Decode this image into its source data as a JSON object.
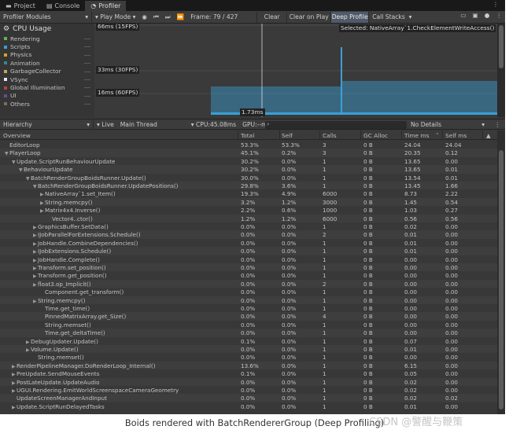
{
  "tabs": [
    {
      "label": "Project",
      "icon": "folder-icon"
    },
    {
      "label": "Console",
      "icon": "console-icon"
    },
    {
      "label": "Profiler",
      "icon": "profiler-icon"
    }
  ],
  "toolbar": {
    "modules": "Profiler Modules",
    "play_mode": "Play Mode",
    "frame": "Frame: 79 / 427",
    "clear": "Clear",
    "clear_on_play": "Clear on Play",
    "deep_profile": "Deep Profile",
    "call_stacks": "Call Stacks"
  },
  "cpu": {
    "title": "CPU Usage",
    "legend": [
      {
        "label": "Rendering",
        "color": "#66b34f"
      },
      {
        "label": "Scripts",
        "color": "#3aa0d6"
      },
      {
        "label": "Physics",
        "color": "#d6a21e"
      },
      {
        "label": "Animation",
        "color": "#2f8b8f"
      },
      {
        "label": "GarbageCollector",
        "color": "#c7a55a"
      },
      {
        "label": "VSync",
        "color": "#e8e8e8"
      },
      {
        "label": "Global Illumination",
        "color": "#b0424a"
      },
      {
        "label": "UI",
        "color": "#6a4a9a"
      },
      {
        "label": "Others",
        "color": "#7f6c5a"
      }
    ]
  },
  "chart": {
    "label_66": "66ms (15FPS)",
    "label_33": "33ms (30FPS)",
    "label_16": "16ms (60FPS)",
    "selected": "Selected: NativeArray`1.CheckElementWriteAccess()",
    "cursor": "1.73ms",
    "accent": "#3aa0d6"
  },
  "hier": {
    "view": "Hierarchy",
    "live": "Live",
    "thread": "Main Thread",
    "cpu": "CPU:45.08ms",
    "gpu": "GPU:--ms",
    "details": "No Details"
  },
  "columns": {
    "overview": "Overview",
    "total": "Total",
    "self": "Self",
    "calls": "Calls",
    "gc": "GC Alloc",
    "time": "Time ms",
    "selfms": "Self ms"
  },
  "rows": [
    [
      "",
      "EditorLoop",
      "53.3%",
      "53.3%",
      "3",
      "0 B",
      "24.04",
      "24.04"
    ],
    [
      "▼",
      "PlayerLoop",
      "45.1%",
      "0.2%",
      "3",
      "0 B",
      "20.35",
      "0.12"
    ],
    [
      "▼",
      "Update.ScriptRunBehaviourUpdate",
      "30.2%",
      "0.0%",
      "1",
      "0 B",
      "13.65",
      "0.00"
    ],
    [
      "▼",
      "BehaviourUpdate",
      "30.2%",
      "0.0%",
      "1",
      "0 B",
      "13.65",
      "0.01"
    ],
    [
      "▼",
      "BatchRenderGroupBoidsRunner.Update()",
      "30.0%",
      "0.0%",
      "1",
      "0 B",
      "13.54",
      "0.01"
    ],
    [
      "▼",
      "BatchRenderGroupBoidsRunner.UpdatePositions()",
      "29.8%",
      "3.6%",
      "1",
      "0 B",
      "13.45",
      "1.66"
    ],
    [
      "▶",
      "NativeArray`1.set_Item()",
      "19.3%",
      "4.9%",
      "6000",
      "0 B",
      "8.73",
      "2.22"
    ],
    [
      "▶",
      "String.memcpy()",
      "3.2%",
      "1.2%",
      "3000",
      "0 B",
      "1.45",
      "0.54"
    ],
    [
      "▶",
      "Matrix4x4.Inverse()",
      "2.2%",
      "0.6%",
      "1000",
      "0 B",
      "1.03",
      "0.27"
    ],
    [
      "",
      "Vector4..ctor()",
      "1.2%",
      "1.2%",
      "6000",
      "0 B",
      "0.56",
      "0.56"
    ],
    [
      "▶",
      "GraphicsBuffer.SetData()",
      "0.0%",
      "0.0%",
      "1",
      "0 B",
      "0.02",
      "0.00"
    ],
    [
      "▶",
      "IJobParallelForExtensions.Schedule()",
      "0.0%",
      "0.0%",
      "2",
      "0 B",
      "0.01",
      "0.00"
    ],
    [
      "▶",
      "JobHandle.CombineDependencies()",
      "0.0%",
      "0.0%",
      "1",
      "0 B",
      "0.01",
      "0.00"
    ],
    [
      "▶",
      "IJobExtensions.Schedule()",
      "0.0%",
      "0.0%",
      "1",
      "0 B",
      "0.01",
      "0.00"
    ],
    [
      "▶",
      "JobHandle.Complete()",
      "0.0%",
      "0.0%",
      "1",
      "0 B",
      "0.00",
      "0.00"
    ],
    [
      "▶",
      "Transform.set_position()",
      "0.0%",
      "0.0%",
      "1",
      "0 B",
      "0.00",
      "0.00"
    ],
    [
      "▶",
      "Transform.get_position()",
      "0.0%",
      "0.0%",
      "1",
      "0 B",
      "0.00",
      "0.00"
    ],
    [
      "▶",
      "float3.op_Implicit()",
      "0.0%",
      "0.0%",
      "2",
      "0 B",
      "0.00",
      "0.00"
    ],
    [
      "",
      "Component.get_transform()",
      "0.0%",
      "0.0%",
      "1",
      "0 B",
      "0.00",
      "0.00"
    ],
    [
      "▶",
      "String.memcpy()",
      "0.0%",
      "0.0%",
      "1",
      "0 B",
      "0.00",
      "0.00"
    ],
    [
      "",
      "Time.get_time()",
      "0.0%",
      "0.0%",
      "1",
      "0 B",
      "0.00",
      "0.00"
    ],
    [
      "",
      "PinnedMatrixArray.get_Size()",
      "0.0%",
      "0.0%",
      "4",
      "0 B",
      "0.00",
      "0.00"
    ],
    [
      "",
      "String.memset()",
      "0.0%",
      "0.0%",
      "1",
      "0 B",
      "0.00",
      "0.00"
    ],
    [
      "",
      "Time.get_deltaTime()",
      "0.0%",
      "0.0%",
      "1",
      "0 B",
      "0.00",
      "0.00"
    ],
    [
      "▶",
      "DebugUpdater.Update()",
      "0.1%",
      "0.0%",
      "1",
      "0 B",
      "0.07",
      "0.00"
    ],
    [
      "▶",
      "Volume.Update()",
      "0.0%",
      "0.0%",
      "1",
      "0 B",
      "0.01",
      "0.00"
    ],
    [
      "",
      "String.memset()",
      "0.0%",
      "0.0%",
      "1",
      "0 B",
      "0.00",
      "0.00"
    ],
    [
      "▶",
      "RenderPipelineManager.DoRenderLoop_Internal()",
      "13.6%",
      "0.0%",
      "1",
      "0 B",
      "6.15",
      "0.00"
    ],
    [
      "▶",
      "PreUpdate.SendMouseEvents",
      "0.1%",
      "0.0%",
      "1",
      "0 B",
      "0.05",
      "0.00"
    ],
    [
      "▶",
      "PostLateUpdate.UpdateAudio",
      "0.0%",
      "0.0%",
      "1",
      "0 B",
      "0.02",
      "0.00"
    ],
    [
      "▶",
      "UGUI.Rendering.EmitWorldScreenspaceCameraGeometry",
      "0.0%",
      "0.0%",
      "1",
      "0 B",
      "0.02",
      "0.00"
    ],
    [
      "",
      "UpdateScreenManagerAndInput",
      "0.0%",
      "0.0%",
      "1",
      "0 B",
      "0.02",
      "0.02"
    ],
    [
      "▶",
      "Update.ScriptRunDelayedTasks",
      "0.0%",
      "0.0%",
      "1",
      "0 B",
      "0.01",
      "0.00"
    ]
  ],
  "caption": "Boids rendered with BatchRendererGroup (Deep Profiling)",
  "watermark": "CSDN @警醒与鞭策"
}
